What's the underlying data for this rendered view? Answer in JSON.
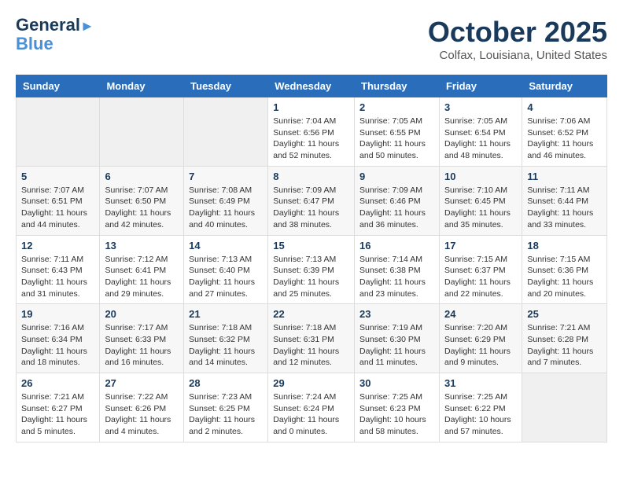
{
  "header": {
    "logo_line1": "General",
    "logo_line2": "Blue",
    "month": "October 2025",
    "location": "Colfax, Louisiana, United States"
  },
  "weekdays": [
    "Sunday",
    "Monday",
    "Tuesday",
    "Wednesday",
    "Thursday",
    "Friday",
    "Saturday"
  ],
  "weeks": [
    [
      {
        "day": "",
        "info": ""
      },
      {
        "day": "",
        "info": ""
      },
      {
        "day": "",
        "info": ""
      },
      {
        "day": "1",
        "info": "Sunrise: 7:04 AM\nSunset: 6:56 PM\nDaylight: 11 hours\nand 52 minutes."
      },
      {
        "day": "2",
        "info": "Sunrise: 7:05 AM\nSunset: 6:55 PM\nDaylight: 11 hours\nand 50 minutes."
      },
      {
        "day": "3",
        "info": "Sunrise: 7:05 AM\nSunset: 6:54 PM\nDaylight: 11 hours\nand 48 minutes."
      },
      {
        "day": "4",
        "info": "Sunrise: 7:06 AM\nSunset: 6:52 PM\nDaylight: 11 hours\nand 46 minutes."
      }
    ],
    [
      {
        "day": "5",
        "info": "Sunrise: 7:07 AM\nSunset: 6:51 PM\nDaylight: 11 hours\nand 44 minutes."
      },
      {
        "day": "6",
        "info": "Sunrise: 7:07 AM\nSunset: 6:50 PM\nDaylight: 11 hours\nand 42 minutes."
      },
      {
        "day": "7",
        "info": "Sunrise: 7:08 AM\nSunset: 6:49 PM\nDaylight: 11 hours\nand 40 minutes."
      },
      {
        "day": "8",
        "info": "Sunrise: 7:09 AM\nSunset: 6:47 PM\nDaylight: 11 hours\nand 38 minutes."
      },
      {
        "day": "9",
        "info": "Sunrise: 7:09 AM\nSunset: 6:46 PM\nDaylight: 11 hours\nand 36 minutes."
      },
      {
        "day": "10",
        "info": "Sunrise: 7:10 AM\nSunset: 6:45 PM\nDaylight: 11 hours\nand 35 minutes."
      },
      {
        "day": "11",
        "info": "Sunrise: 7:11 AM\nSunset: 6:44 PM\nDaylight: 11 hours\nand 33 minutes."
      }
    ],
    [
      {
        "day": "12",
        "info": "Sunrise: 7:11 AM\nSunset: 6:43 PM\nDaylight: 11 hours\nand 31 minutes."
      },
      {
        "day": "13",
        "info": "Sunrise: 7:12 AM\nSunset: 6:41 PM\nDaylight: 11 hours\nand 29 minutes."
      },
      {
        "day": "14",
        "info": "Sunrise: 7:13 AM\nSunset: 6:40 PM\nDaylight: 11 hours\nand 27 minutes."
      },
      {
        "day": "15",
        "info": "Sunrise: 7:13 AM\nSunset: 6:39 PM\nDaylight: 11 hours\nand 25 minutes."
      },
      {
        "day": "16",
        "info": "Sunrise: 7:14 AM\nSunset: 6:38 PM\nDaylight: 11 hours\nand 23 minutes."
      },
      {
        "day": "17",
        "info": "Sunrise: 7:15 AM\nSunset: 6:37 PM\nDaylight: 11 hours\nand 22 minutes."
      },
      {
        "day": "18",
        "info": "Sunrise: 7:15 AM\nSunset: 6:36 PM\nDaylight: 11 hours\nand 20 minutes."
      }
    ],
    [
      {
        "day": "19",
        "info": "Sunrise: 7:16 AM\nSunset: 6:34 PM\nDaylight: 11 hours\nand 18 minutes."
      },
      {
        "day": "20",
        "info": "Sunrise: 7:17 AM\nSunset: 6:33 PM\nDaylight: 11 hours\nand 16 minutes."
      },
      {
        "day": "21",
        "info": "Sunrise: 7:18 AM\nSunset: 6:32 PM\nDaylight: 11 hours\nand 14 minutes."
      },
      {
        "day": "22",
        "info": "Sunrise: 7:18 AM\nSunset: 6:31 PM\nDaylight: 11 hours\nand 12 minutes."
      },
      {
        "day": "23",
        "info": "Sunrise: 7:19 AM\nSunset: 6:30 PM\nDaylight: 11 hours\nand 11 minutes."
      },
      {
        "day": "24",
        "info": "Sunrise: 7:20 AM\nSunset: 6:29 PM\nDaylight: 11 hours\nand 9 minutes."
      },
      {
        "day": "25",
        "info": "Sunrise: 7:21 AM\nSunset: 6:28 PM\nDaylight: 11 hours\nand 7 minutes."
      }
    ],
    [
      {
        "day": "26",
        "info": "Sunrise: 7:21 AM\nSunset: 6:27 PM\nDaylight: 11 hours\nand 5 minutes."
      },
      {
        "day": "27",
        "info": "Sunrise: 7:22 AM\nSunset: 6:26 PM\nDaylight: 11 hours\nand 4 minutes."
      },
      {
        "day": "28",
        "info": "Sunrise: 7:23 AM\nSunset: 6:25 PM\nDaylight: 11 hours\nand 2 minutes."
      },
      {
        "day": "29",
        "info": "Sunrise: 7:24 AM\nSunset: 6:24 PM\nDaylight: 11 hours\nand 0 minutes."
      },
      {
        "day": "30",
        "info": "Sunrise: 7:25 AM\nSunset: 6:23 PM\nDaylight: 10 hours\nand 58 minutes."
      },
      {
        "day": "31",
        "info": "Sunrise: 7:25 AM\nSunset: 6:22 PM\nDaylight: 10 hours\nand 57 minutes."
      },
      {
        "day": "",
        "info": ""
      }
    ]
  ]
}
